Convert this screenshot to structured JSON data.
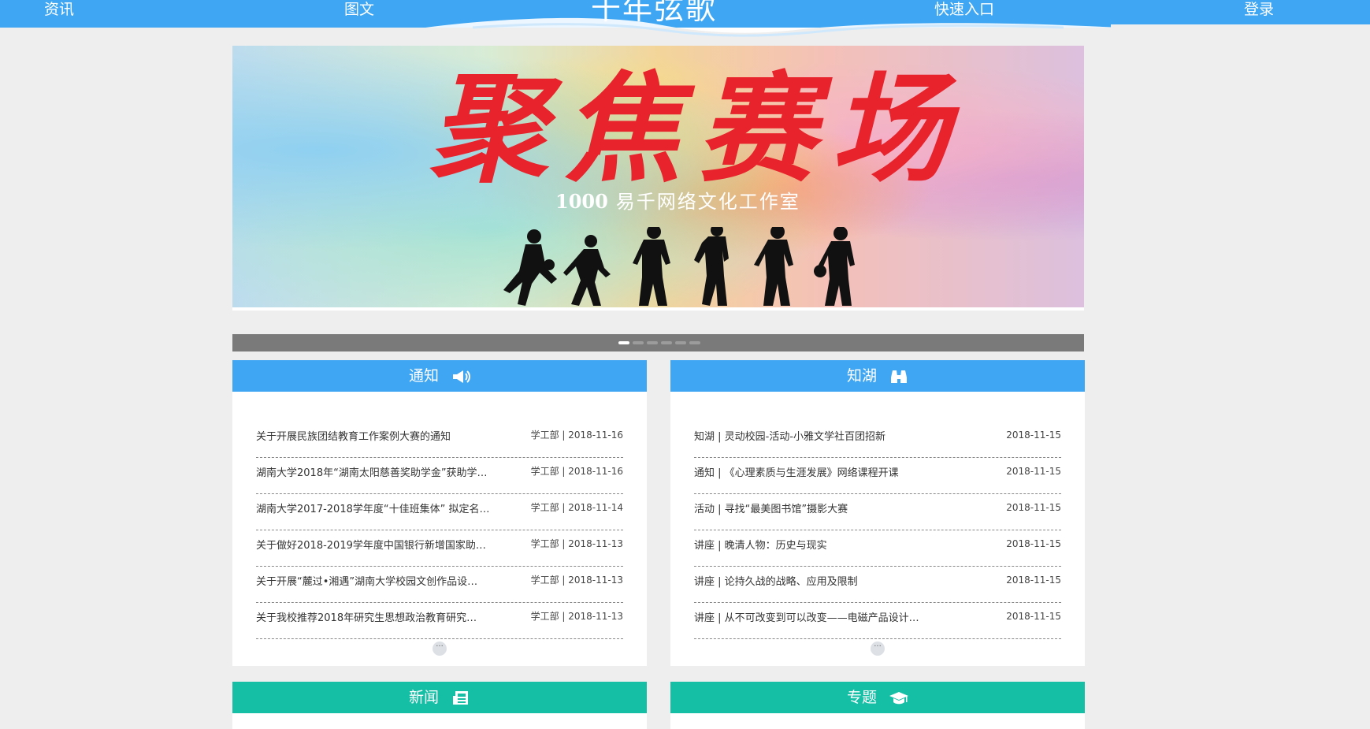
{
  "nav": {
    "items": [
      {
        "label": "资讯"
      },
      {
        "label": "图文"
      },
      {
        "label": "快速入口"
      },
      {
        "label": "登录"
      }
    ],
    "brand": "千年弦歌"
  },
  "banner": {
    "title": "聚焦赛场",
    "logo_number": "1000",
    "subtitle": "易千网络文化工作室"
  },
  "carousel": {
    "slide_count": 6,
    "active_index": 0
  },
  "panels": {
    "notice": {
      "title": "通知",
      "icon": "megaphone-icon",
      "items": [
        {
          "title": "关于开展民族团结教育工作案例大赛的通知",
          "meta": "学工部 | 2018-11-16"
        },
        {
          "title": "湖南大学2018年“湖南太阳慈善奖助学金”获助学…",
          "meta": "学工部 | 2018-11-16"
        },
        {
          "title": "湖南大学2017-2018学年度“十佳班集体” 拟定名…",
          "meta": "学工部 | 2018-11-14"
        },
        {
          "title": "关于做好2018-2019学年度中国银行新增国家助…",
          "meta": "学工部 | 2018-11-13"
        },
        {
          "title": "关于开展“麓过•湘遇”湖南大学校园文创作品设…",
          "meta": "学工部 | 2018-11-13"
        },
        {
          "title": "关于我校推荐2018年研究生思想政治教育研究…",
          "meta": "学工部 | 2018-11-13"
        }
      ],
      "more": "···"
    },
    "zhihu": {
      "title": "知湖",
      "icon": "binoculars-icon",
      "items": [
        {
          "title": "知湖 | 灵动校园-活动-小雅文学社百团招新",
          "meta": "2018-11-15"
        },
        {
          "title": "通知 | 《心理素质与生涯发展》网络课程开课",
          "meta": "2018-11-15"
        },
        {
          "title": "活动 | 寻找“最美图书馆”摄影大赛",
          "meta": "2018-11-15"
        },
        {
          "title": "讲座 | 晚清人物：历史与现实",
          "meta": "2018-11-15"
        },
        {
          "title": "讲座 | 论持久战的战略、应用及限制",
          "meta": "2018-11-15"
        },
        {
          "title": "讲座 | 从不可改变到可以改变——电磁产品设计…",
          "meta": "2018-11-15"
        }
      ],
      "more": "···"
    },
    "news": {
      "title": "新闻",
      "icon": "newspaper-icon"
    },
    "topics": {
      "title": "专题",
      "icon": "graduation-cap-icon"
    }
  },
  "colors": {
    "nav_blue": "#3ea6f3",
    "teal": "#14bfa6",
    "banner_title_red": "#e8232c"
  }
}
